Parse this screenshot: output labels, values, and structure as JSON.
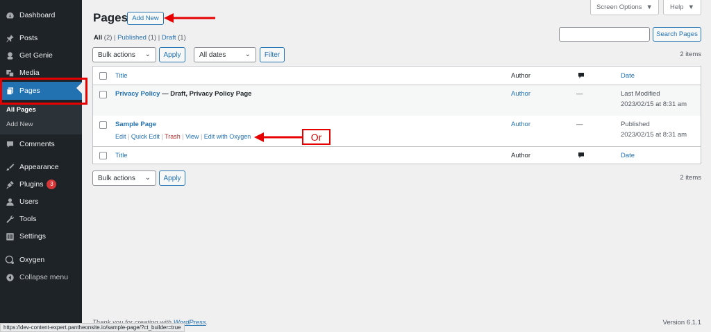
{
  "sidebar": {
    "items": [
      {
        "label": "Dashboard",
        "icon": "dashboard-icon"
      },
      {
        "label": "Posts",
        "icon": "pin-icon"
      },
      {
        "label": "Get Genie",
        "icon": "genie-icon"
      },
      {
        "label": "Media",
        "icon": "media-icon"
      },
      {
        "label": "Pages",
        "icon": "page-icon"
      },
      {
        "label": "Comments",
        "icon": "comment-icon"
      },
      {
        "label": "Appearance",
        "icon": "brush-icon"
      },
      {
        "label": "Plugins",
        "icon": "plug-icon",
        "badge": "3"
      },
      {
        "label": "Users",
        "icon": "user-icon"
      },
      {
        "label": "Tools",
        "icon": "wrench-icon"
      },
      {
        "label": "Settings",
        "icon": "settings-icon"
      },
      {
        "label": "Oxygen",
        "icon": "oxygen-icon"
      },
      {
        "label": "Collapse menu",
        "icon": "collapse-icon"
      }
    ],
    "submenu": [
      "All Pages",
      "Add New"
    ]
  },
  "header": {
    "screen_options": "Screen Options",
    "help": "Help",
    "title": "Pages",
    "add_new": "Add New"
  },
  "views": {
    "all": "All",
    "all_count": "(2)",
    "published": "Published",
    "published_count": "(1)",
    "draft": "Draft",
    "draft_count": "(1)",
    "sep": "|"
  },
  "search": {
    "button": "Search Pages",
    "placeholder": ""
  },
  "filters": {
    "bulk_actions": "Bulk actions",
    "apply": "Apply",
    "all_dates": "All dates",
    "filter": "Filter",
    "items_count": "2 items"
  },
  "table": {
    "columns": {
      "title": "Title",
      "author": "Author",
      "date": "Date"
    },
    "rows": [
      {
        "title": "Privacy Policy",
        "state": " — Draft, Privacy Policy Page",
        "author": "Author",
        "comments": "—",
        "status": "Last Modified",
        "date": "2023/02/15 at 8:31 am"
      },
      {
        "title": "Sample Page",
        "state": "",
        "author": "Author",
        "comments": "—",
        "status": "Published",
        "date": "2023/02/15 at 8:31 am",
        "actions": [
          "Edit",
          "Quick Edit",
          "Trash",
          "View",
          "Edit with Oxygen"
        ]
      }
    ]
  },
  "annotation": {
    "or_label": "Or",
    "color": "#e60000"
  },
  "footer": {
    "thanks": "Thank you for creating with ",
    "wp_link": "WordPress",
    "period": ".",
    "version": "Version 6.1.1"
  },
  "status_bar": {
    "url": "https://dev-content-expert.pantheonsite.io/sample-page/?ct_builder=true"
  },
  "colors": {
    "sidebar": "#1d2327",
    "accent": "#2271b1",
    "active": "#2271b1",
    "annotation": "#e60000"
  }
}
